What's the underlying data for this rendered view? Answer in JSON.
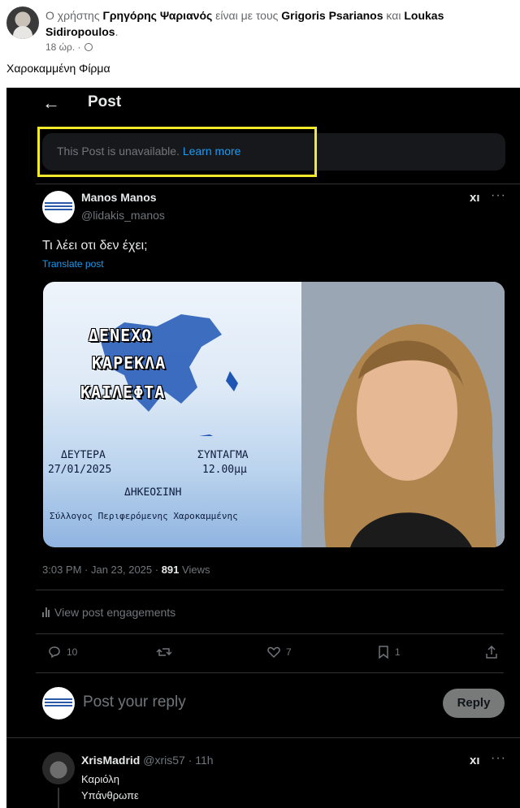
{
  "facebook": {
    "prefix": "Ο χρήστης ",
    "author": "Γρηγόρης Ψαριανός",
    "with_text": " είναι με τους ",
    "tag1": "Grigoris Psarianos",
    "and_text": " και ",
    "tag2": "Loukas Sidiropoulos",
    "period": ".",
    "time": "18 ώρ. ·",
    "caption": "Χαροκαμμένη Φίρμα"
  },
  "x_post": {
    "header_title": "Post",
    "unavailable_text": "This Post is unavailable.",
    "learn_more": "Learn more",
    "author_name": "Manos Manos",
    "author_handle": "@lidakis_manos",
    "grok_label": "xı",
    "more_label": "···",
    "text": "Τι λέει οτι δεν έχει;",
    "translate": "Translate post",
    "poster": {
      "line1": "ΔΕΝΕΧΩ",
      "line2": "ΚΑΡΕΚΛΑ",
      "line3": "ΚΑΙΛΕΦΤΑ",
      "day": "ΔΕΥΤΕΡΑ",
      "date": "27/01/2025",
      "place": "ΣΥΝΤΑΓΜΑ",
      "hour": "12.00μμ",
      "event": "ΔΗΚΕΟΣΙΝΗ",
      "org": "Σύλλογος Περιφερόμενης Χαροκαμμένης"
    },
    "timestamp": "3:03 PM · Jan 23, 2025 · ",
    "views_count": "891",
    "views_label": " Views",
    "engagements": "View post engagements",
    "replies": "10",
    "likes": "7",
    "bookmarks": "1",
    "reply_placeholder": "Post your reply",
    "reply_button": "Reply"
  },
  "comment": {
    "name": "XrisMadrid",
    "meta": " @xris57 · 11h",
    "line1": "Καριόλη",
    "line2": "Υπάνθρωπε"
  },
  "colors": {
    "x_background": "#000000",
    "x_link": "#1d9bf0",
    "highlight_box": "#f2e92b"
  }
}
